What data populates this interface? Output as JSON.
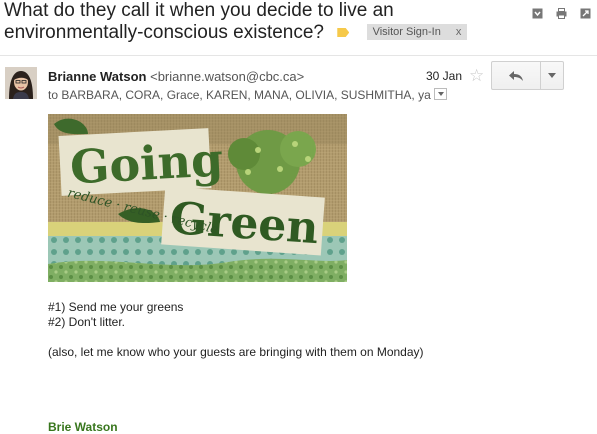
{
  "email": {
    "subject": "What do they call it when you decide to live an environmentally-conscious existence?",
    "label_chip": "Visitor Sign-In",
    "label_chip_close": "x",
    "sender_name": "Brianne Watson",
    "sender_email": "<brianne.watson@cbc.ca>",
    "date": "30 Jan",
    "recipients": "to BARBARA, CORA, Grace, KAREN, MANA, OLIVIA, SUSHMITHA, ya",
    "body_lines": [
      "#1) Send me your greens",
      "#2) Don't litter.",
      "(also, let me know who your guests are bringing with them on Monday)"
    ],
    "signature": "Brie Watson"
  },
  "banner": {
    "title_line1": "Going",
    "title_line2": "Green",
    "tagline": "reduce · reuse · recycle"
  },
  "icons": {
    "top": [
      "archive-icon",
      "print-icon",
      "new-window-icon"
    ],
    "reply": "reply-icon",
    "more": "chevron-down-icon",
    "star": "star-icon"
  },
  "colors": {
    "label_tag": "#f6c94a",
    "signature": "#38761d"
  }
}
